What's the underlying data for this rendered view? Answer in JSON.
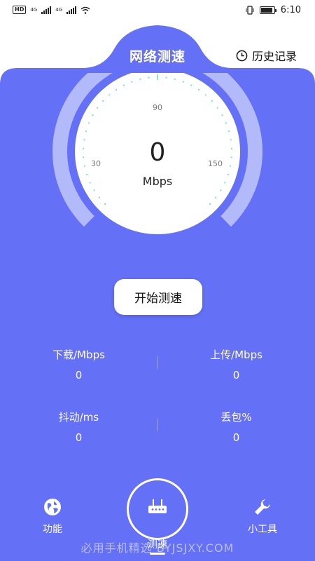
{
  "status_bar": {
    "hd": "HD",
    "net1": "4G",
    "net2": "4G",
    "time": "6:10"
  },
  "header": {
    "title": "网络测速",
    "history_label": "历史记录"
  },
  "gauge": {
    "value": "0",
    "unit": "Mbps",
    "tick_min": "30",
    "tick_mid": "90",
    "tick_max": "150"
  },
  "start_button": "开始测速",
  "stats": {
    "download_label": "下载/Mbps",
    "download_value": "0",
    "upload_label": "上传/Mbps",
    "upload_value": "0",
    "jitter_label": "抖动/ms",
    "jitter_value": "0",
    "loss_label": "丢包%",
    "loss_value": "0"
  },
  "nav": {
    "features": "功能",
    "speedtest": "测速",
    "tools": "小工具"
  },
  "watermark": "必用手机精选 BYJSJXY.COM",
  "colors": {
    "primary": "#6470F6",
    "ring": "#B3BAFA",
    "dial_tick": "#7FDCCF"
  }
}
